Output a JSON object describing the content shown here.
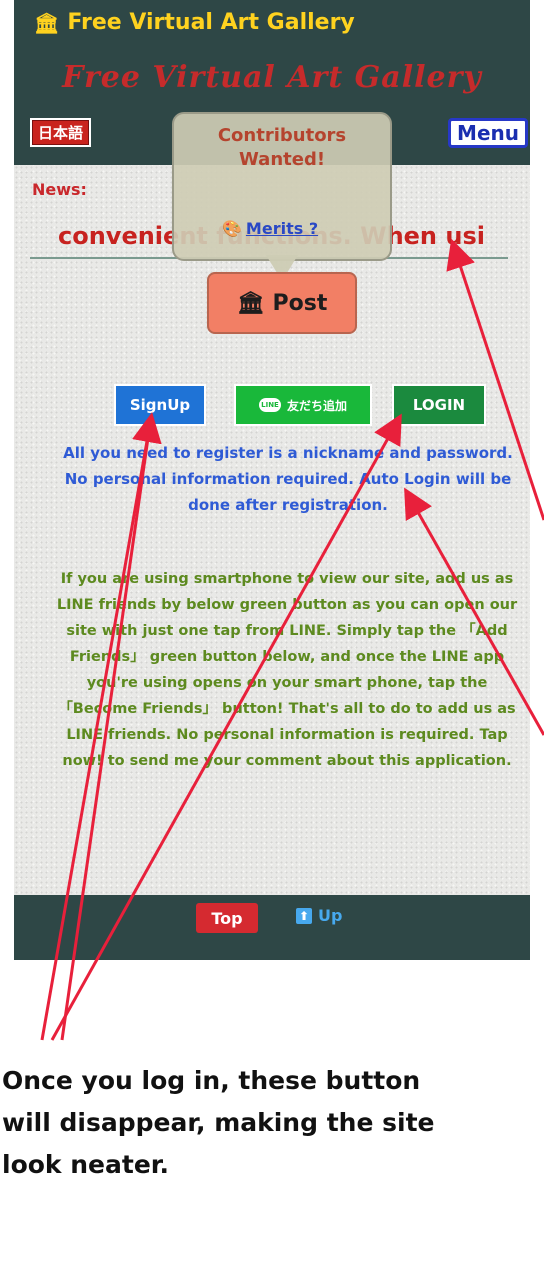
{
  "header": {
    "app_title": "Free Virtual Art Gallery",
    "cursive_title": "Free Virtual Art Gallery",
    "language_button": "日本語",
    "menu_button": "Menu"
  },
  "popup": {
    "title": "Contributors Wanted!",
    "merits_link": "Merits ?"
  },
  "news": {
    "label": "News:",
    "ticker_text": "convenient functions. When usi"
  },
  "post_button": "Post",
  "buttons": {
    "signup": "SignUp",
    "line_add": "友だち追加",
    "line_badge": "LINE",
    "login": "LOGIN"
  },
  "info": {
    "register_text": "All you need to register is a nickname and password. No personal information required. Auto Login will be done after registration.",
    "line_text": "If you are using smartphone to view our site, add us as LINE friends by below green button as you can open our site with just one tap from LINE. Simply tap the 「Add Friends」 green button below, and once the LINE app you're using opens on your smart phone, tap the 「Become Friends」 button! That's all to do to add us as LINE friends. No personal information is required. Tap now! to send me your comment about this application."
  },
  "footer": {
    "top_button": "Top",
    "up_link": "Up"
  },
  "annotation": {
    "caption": "Once you log in, these button\nwill disappear, making the site\nlook neater.",
    "arrow_color": "#e8203b"
  },
  "colors": {
    "header_bg": "#2e4746",
    "app_title": "#ffd21f",
    "accent_red": "#c9231e",
    "signup_blue": "#1f73d6",
    "line_green": "#19b83a",
    "login_green": "#1b8a3e",
    "post_orange": "#f27f65"
  },
  "icons": {
    "gallery": "museum-building-icon",
    "palette": "palette-icon",
    "up": "up-arrow-icon"
  }
}
